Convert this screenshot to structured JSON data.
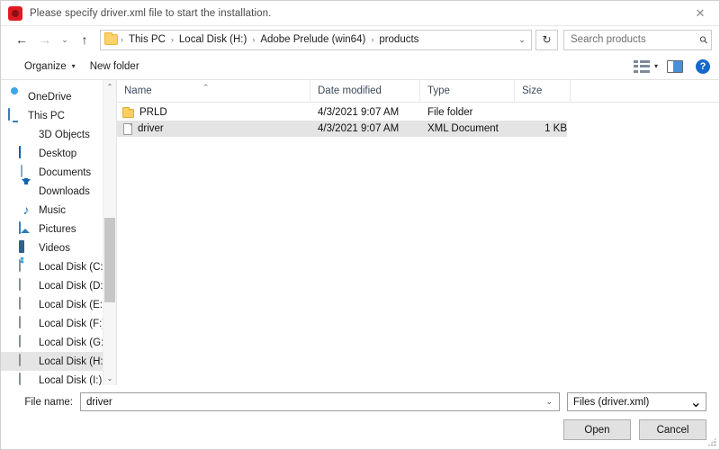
{
  "window": {
    "title": "Please specify driver.xml file to start the installation.",
    "app_icon": "adobe-prelude-icon",
    "close_label": "✕"
  },
  "nav": {
    "back": "←",
    "forward": "→",
    "recent": "⌄",
    "up": "↑",
    "refresh": "↻",
    "breadcrumb": [
      "This PC",
      "Local Disk (H:)",
      "Adobe Prelude (win64)",
      "products"
    ],
    "breadcrumb_separator": "›",
    "breadcrumb_dropdown": "⌄",
    "search_placeholder": "Search products",
    "search_icon": "⚲"
  },
  "toolbar": {
    "organize_label": "Organize",
    "organize_caret": "▾",
    "new_folder_label": "New folder",
    "view_caret": "▾",
    "help_label": "?"
  },
  "sidebar": {
    "items": [
      {
        "label": "OneDrive",
        "icon": "cloud-icon",
        "indent": false,
        "selected": false
      },
      {
        "label": "This PC",
        "icon": "pc-icon",
        "indent": false,
        "selected": false
      },
      {
        "label": "3D Objects",
        "icon": "3d-objects-icon",
        "indent": true,
        "selected": false
      },
      {
        "label": "Desktop",
        "icon": "desktop-icon",
        "indent": true,
        "selected": false
      },
      {
        "label": "Documents",
        "icon": "documents-icon",
        "indent": true,
        "selected": false
      },
      {
        "label": "Downloads",
        "icon": "downloads-icon",
        "indent": true,
        "selected": false
      },
      {
        "label": "Music",
        "icon": "music-icon",
        "indent": true,
        "selected": false
      },
      {
        "label": "Pictures",
        "icon": "pictures-icon",
        "indent": true,
        "selected": false
      },
      {
        "label": "Videos",
        "icon": "videos-icon",
        "indent": true,
        "selected": false
      },
      {
        "label": "Local Disk (C:)",
        "icon": "windows-drive-icon",
        "indent": true,
        "selected": false
      },
      {
        "label": "Local Disk (D:)",
        "icon": "drive-icon",
        "indent": true,
        "selected": false
      },
      {
        "label": "Local Disk (E:)",
        "icon": "drive-icon",
        "indent": true,
        "selected": false
      },
      {
        "label": "Local Disk (F:)",
        "icon": "drive-icon",
        "indent": true,
        "selected": false
      },
      {
        "label": "Local Disk (G:)",
        "icon": "drive-icon",
        "indent": true,
        "selected": false
      },
      {
        "label": "Local Disk (H:)",
        "icon": "drive-icon",
        "indent": true,
        "selected": true
      },
      {
        "label": "Local Disk (I:)",
        "icon": "drive-icon",
        "indent": true,
        "selected": false
      }
    ],
    "scroll_up": "⌃",
    "scroll_down": "⌄"
  },
  "filelist": {
    "columns": [
      "Name",
      "Date modified",
      "Type",
      "Size"
    ],
    "sort_caret": "⌃",
    "rows": [
      {
        "name": "PRLD",
        "date": "4/3/2021 9:07 AM",
        "type": "File folder",
        "size": "",
        "icon": "folder-icon",
        "selected": false
      },
      {
        "name": "driver",
        "date": "4/3/2021 9:07 AM",
        "type": "XML Document",
        "size": "1 KB",
        "icon": "file-icon",
        "selected": true
      }
    ]
  },
  "footer": {
    "filename_label": "File name:",
    "filename_value": "driver",
    "filename_caret": "⌄",
    "filetype_value": "Files (driver.xml)",
    "filetype_caret": "⌄",
    "open_label": "Open",
    "cancel_label": "Cancel"
  }
}
